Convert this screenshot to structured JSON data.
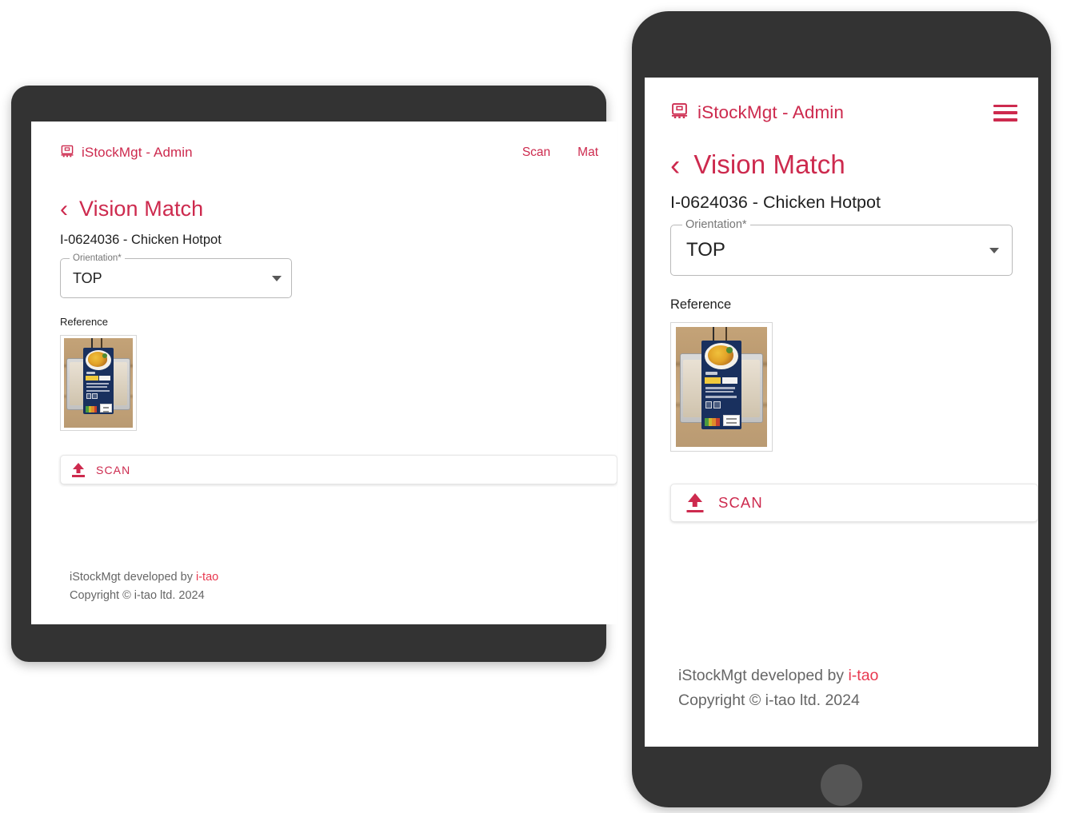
{
  "app": {
    "brand_name": "iStockMgt - Admin",
    "brand_icon": "desktop-monitor-icon",
    "accent_color": "#cd2a4e",
    "bezel_color": "#333333"
  },
  "tablet": {
    "nav_links": [
      "Scan",
      "Mat"
    ],
    "page": {
      "back_icon": "chevron-left-icon",
      "title": "Vision Match",
      "item_name": "I-0624036 - Chicken Hotpot"
    },
    "orientation_field": {
      "label": "Orientation*",
      "value": "TOP",
      "dropdown_icon": "chevron-down-icon",
      "options": [
        "TOP"
      ]
    },
    "reference": {
      "label": "Reference",
      "image_alt": "Chicken Hotpot packaged tray on cardboard"
    },
    "scan_button": {
      "label": "SCAN",
      "icon": "upload-icon"
    },
    "footer": {
      "line1_prefix": "iStockMgt developed by ",
      "line1_accent": "i-tao",
      "line2": "Copyright © i-tao ltd. 2024"
    }
  },
  "phone": {
    "menu_icon": "hamburger-menu-icon",
    "page": {
      "back_icon": "chevron-left-icon",
      "title": "Vision Match",
      "item_name": "I-0624036 - Chicken Hotpot"
    },
    "orientation_field": {
      "label": "Orientation*",
      "value": "TOP",
      "dropdown_icon": "chevron-down-icon",
      "options": [
        "TOP"
      ]
    },
    "reference": {
      "label": "Reference",
      "image_alt": "Chicken Hotpot packaged tray on cardboard"
    },
    "scan_button": {
      "label": "SCAN",
      "icon": "upload-icon"
    },
    "footer": {
      "line1_prefix": "iStockMgt developed by ",
      "line1_accent": "i-tao",
      "line2": "Copyright © i-tao ltd. 2024"
    }
  },
  "product_photo": {
    "label_title": "CHICKEN HOTPOT",
    "label_bg": "#19305e",
    "traffic_light_colors": [
      "#4c9b3f",
      "#cfb92f",
      "#e08a2a",
      "#c8402f"
    ]
  }
}
